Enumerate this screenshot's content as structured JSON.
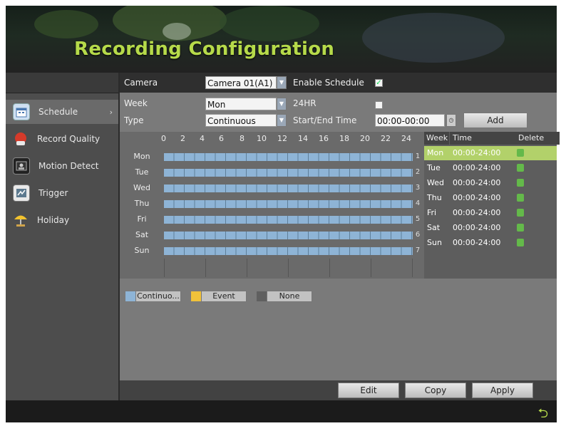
{
  "page": {
    "title": "Recording Configuration"
  },
  "sidebar": {
    "items": [
      {
        "label": "Schedule",
        "icon": "calendar-icon",
        "active": true
      },
      {
        "label": "Record Quality",
        "icon": "record-quality-icon",
        "active": false
      },
      {
        "label": "Motion Detect",
        "icon": "motion-detect-icon",
        "active": false
      },
      {
        "label": "Trigger",
        "icon": "trigger-icon",
        "active": false
      },
      {
        "label": "Holiday",
        "icon": "umbrella-icon",
        "active": false
      }
    ]
  },
  "camera": {
    "label": "Camera",
    "value": "Camera 01(A1)",
    "enable_label": "Enable Schedule",
    "enabled": true
  },
  "week": {
    "label": "Week",
    "value": "Mon",
    "hr24_label": "24HR",
    "hr24_checked": false
  },
  "type": {
    "label": "Type",
    "value": "Continuous",
    "time_label": "Start/End Time",
    "time_value": "00:00-00:00",
    "add_label": "Add"
  },
  "grid": {
    "hours": [
      "0",
      "2",
      "4",
      "6",
      "8",
      "10",
      "12",
      "14",
      "16",
      "18",
      "20",
      "22",
      "24"
    ],
    "days": [
      "Mon",
      "Tue",
      "Wed",
      "Thu",
      "Fri",
      "Sat",
      "Sun"
    ],
    "row_numbers": [
      "1",
      "2",
      "3",
      "4",
      "5",
      "6",
      "7"
    ]
  },
  "periods": {
    "headers": {
      "week": "Week",
      "time": "Time",
      "delete": "Delete"
    },
    "rows": [
      {
        "day": "Mon",
        "time": "00:00-24:00",
        "selected": true
      },
      {
        "day": "Tue",
        "time": "00:00-24:00",
        "selected": false
      },
      {
        "day": "Wed",
        "time": "00:00-24:00",
        "selected": false
      },
      {
        "day": "Thu",
        "time": "00:00-24:00",
        "selected": false
      },
      {
        "day": "Fri",
        "time": "00:00-24:00",
        "selected": false
      },
      {
        "day": "Sat",
        "time": "00:00-24:00",
        "selected": false
      },
      {
        "day": "Sun",
        "time": "00:00-24:00",
        "selected": false
      }
    ]
  },
  "legend": [
    {
      "label": "Continuo...",
      "color": "#8eb4d6"
    },
    {
      "label": "Event",
      "color": "#f0c23a"
    },
    {
      "label": "None",
      "color": "#6a6a6a"
    }
  ],
  "buttons": {
    "edit": "Edit",
    "copy": "Copy",
    "apply": "Apply"
  },
  "colors": {
    "accent": "#b6da4a",
    "schedule_blue": "#8eb4d6"
  }
}
